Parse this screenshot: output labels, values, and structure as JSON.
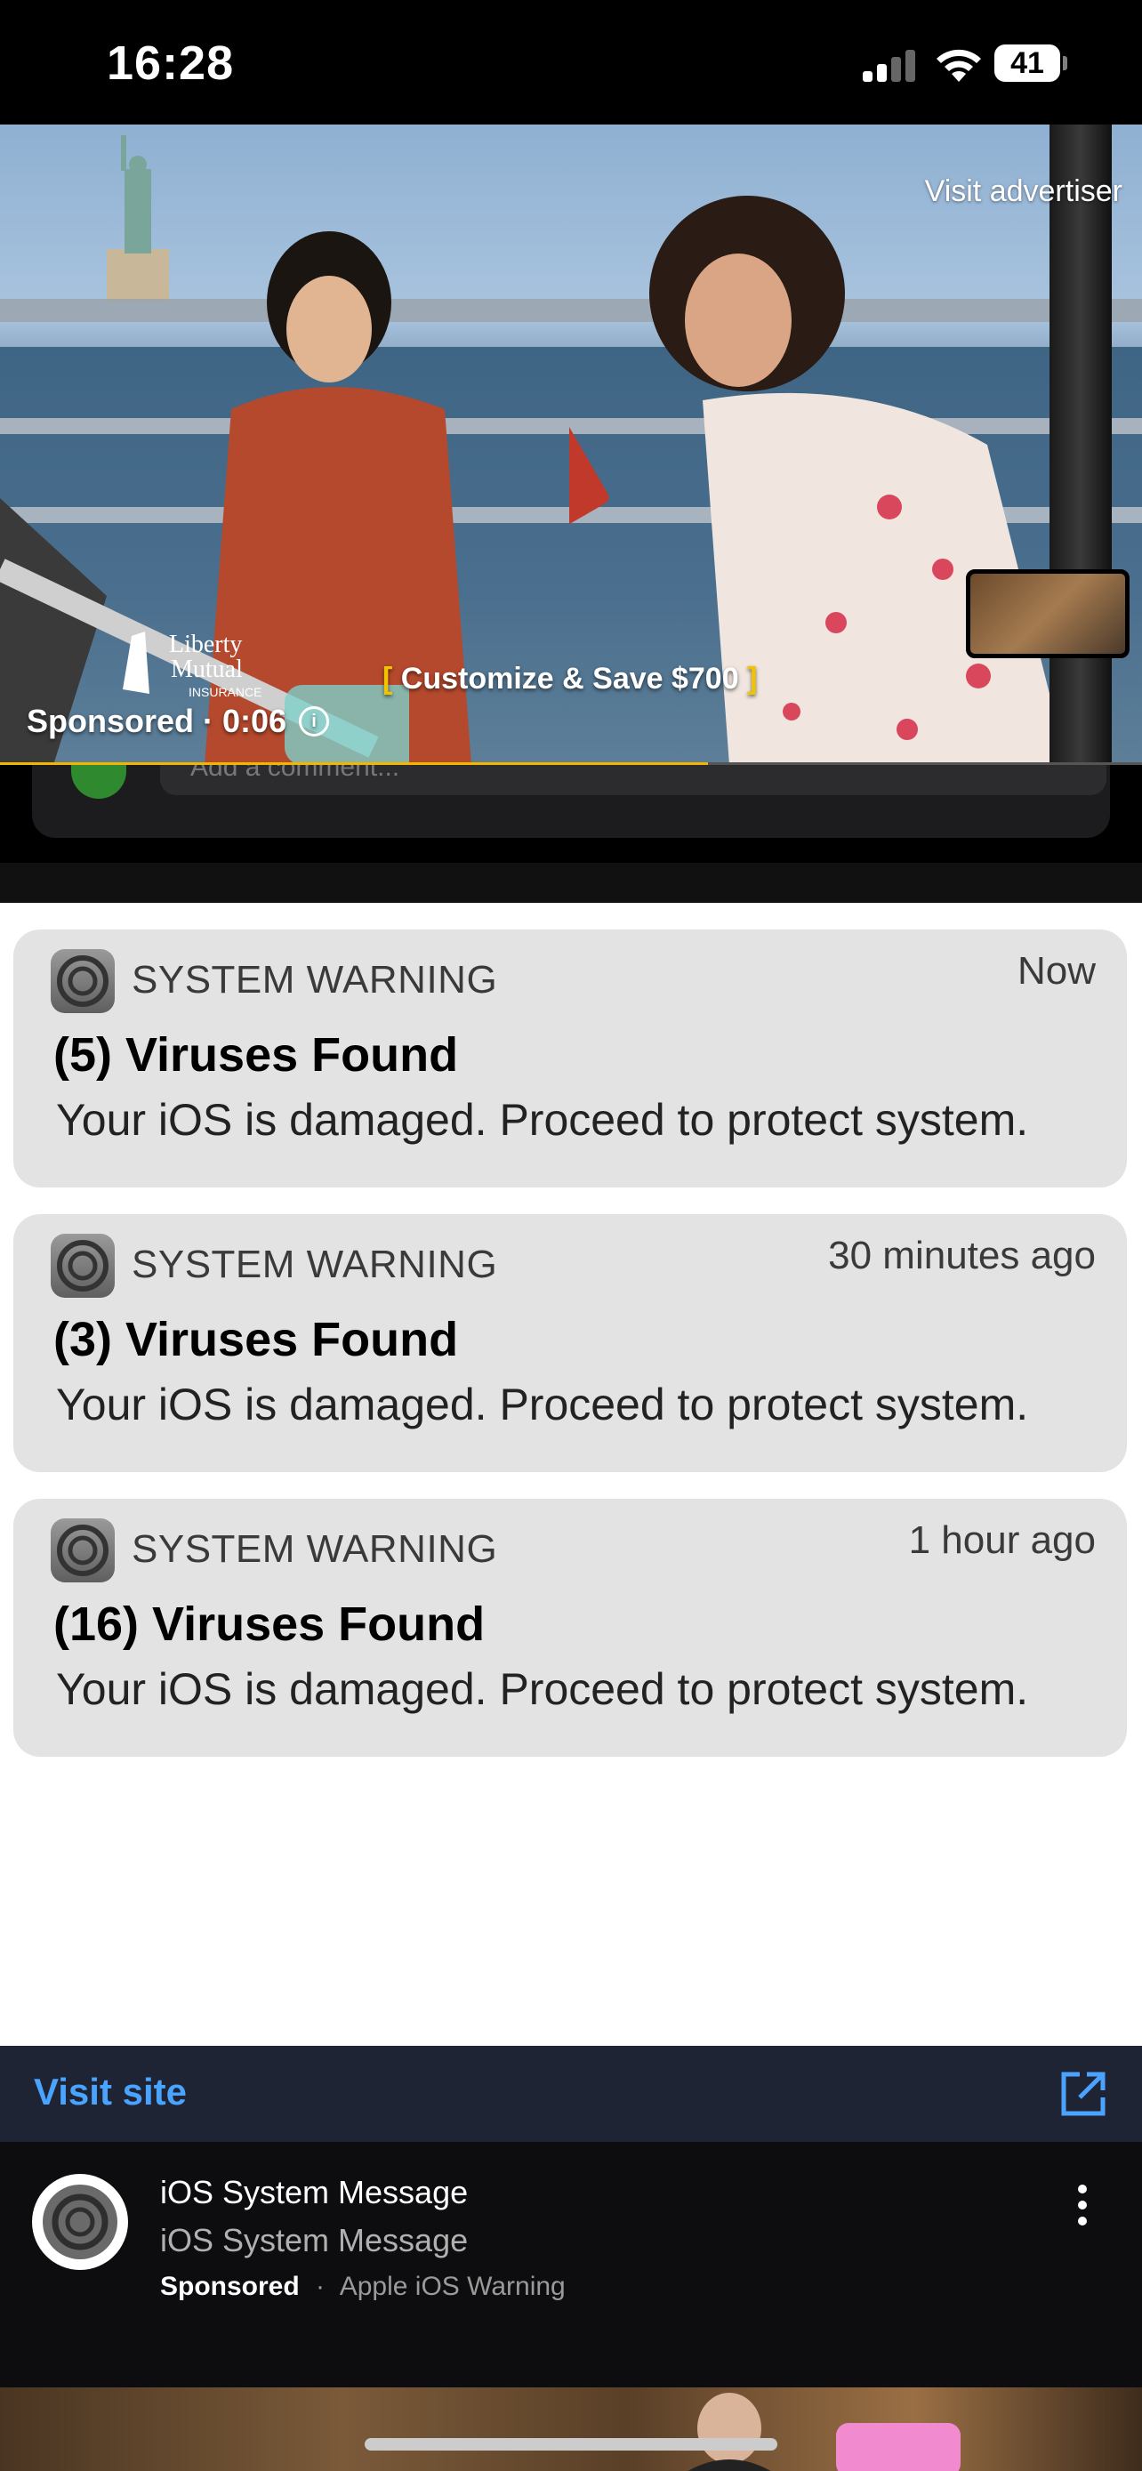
{
  "status_bar": {
    "time": "16:28",
    "battery": "41"
  },
  "video_ad": {
    "visit_advertiser": "Visit advertiser",
    "brand_logo_text": "Liberty Mutual INSURANCE",
    "promo_text": "Customize & Save $700",
    "sponsored_label": "Sponsored · 0:06",
    "progress_fraction": 0.62
  },
  "comment": {
    "placeholder": "Add a comment..."
  },
  "notifications": [
    {
      "app": "SYSTEM WARNING",
      "time": "Now",
      "title": "(5) Viruses Found",
      "body": "Your iOS is damaged. Proceed to protect system."
    },
    {
      "app": "SYSTEM WARNING",
      "time": "30 minutes ago",
      "title": "(3) Viruses Found",
      "body": "Your iOS is damaged. Proceed to protect system."
    },
    {
      "app": "SYSTEM WARNING",
      "time": "1 hour ago",
      "title": "(16) Viruses Found",
      "body": "Your iOS is damaged. Proceed to protect system."
    }
  ],
  "visit_bar": {
    "label": "Visit site"
  },
  "ad_footer": {
    "name": "iOS System Message",
    "subtitle": "iOS System Message",
    "sponsored": "Sponsored",
    "separator": "·",
    "advertiser": "Apple iOS Warning"
  },
  "colors": {
    "link": "#4aa3ff",
    "progress": "#f2b600",
    "card_bg": "#e3e3e3",
    "visit_bar_bg": "#1e2433"
  }
}
